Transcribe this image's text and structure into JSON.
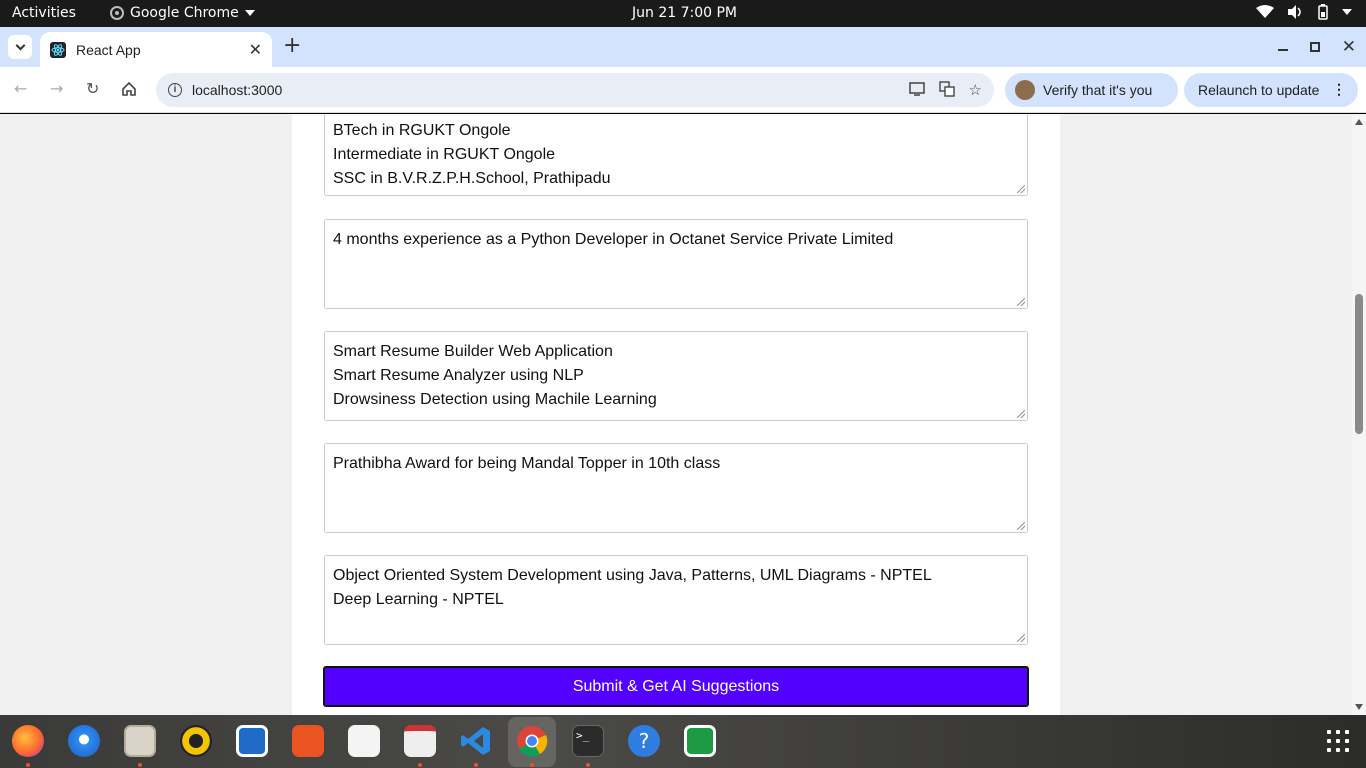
{
  "topbar": {
    "activities": "Activities",
    "app_name": "Google Chrome",
    "clock": "Jun 21  7:00 PM"
  },
  "browser": {
    "tab_title": "React App",
    "url": "localhost:3000",
    "verify_label": "Verify that it's you",
    "relaunch_label": "Relaunch to update"
  },
  "form": {
    "education": [
      "BTech in RGUKT Ongole",
      "Intermediate in RGUKT Ongole",
      "SSC in B.V.R.Z.P.H.School, Prathipadu"
    ],
    "experience": [
      "4 months experience as a Python Developer in Octanet Service Private Limited"
    ],
    "projects": [
      "Smart Resume Builder Web Application",
      "Smart Resume Analyzer using NLP",
      "Drowsiness Detection using Machile Learning"
    ],
    "achievements": [
      "Prathibha Award for being Mandal Topper in 10th class"
    ],
    "certifications": [
      "Object Oriented System Development using Java, Patterns, UML Diagrams - NPTEL",
      "Deep Learning - NPTEL"
    ],
    "submit_label": "Submit & Get AI Suggestions"
  },
  "dock": {
    "apps": [
      "firefox-icon",
      "thunderbird-icon",
      "files-icon",
      "rhythmbox-icon",
      "writer-icon",
      "app-center-icon",
      "text-editor-icon",
      "document-viewer-icon",
      "vscode-icon",
      "chrome-icon",
      "terminal-icon",
      "help-icon",
      "calc-icon"
    ]
  }
}
